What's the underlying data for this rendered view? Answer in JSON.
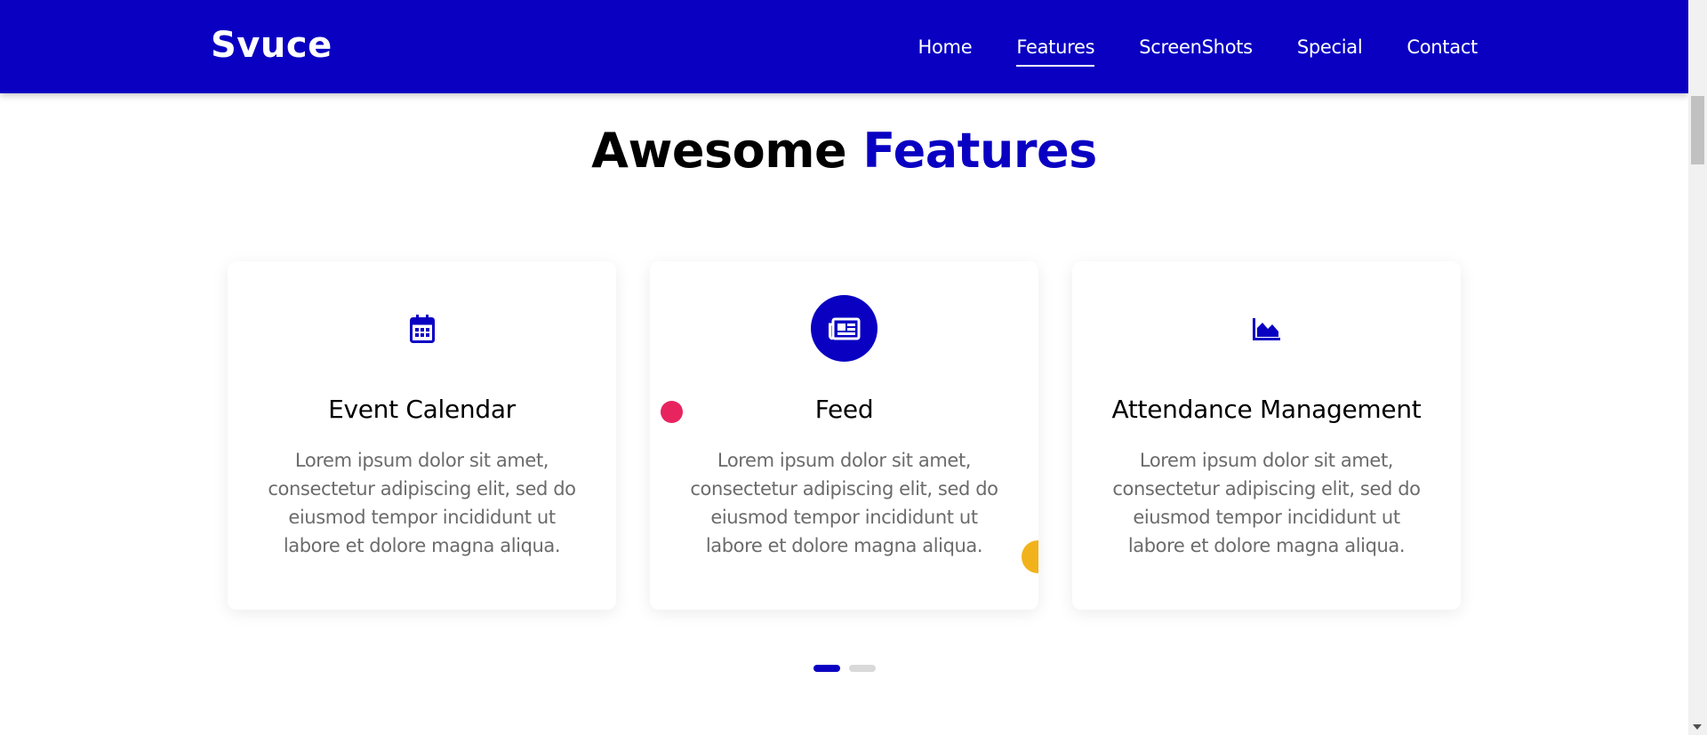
{
  "brand": "Svuce",
  "nav": [
    "Home",
    "Features",
    "ScreenShots",
    "Special",
    "Contact"
  ],
  "nav_active_index": 1,
  "section": {
    "title_prefix": "Awesome",
    "title_accent": "Features"
  },
  "cards": [
    {
      "title": "Event Calendar",
      "icon": "calendar-icon",
      "text": "Lorem ipsum dolor sit amet, consectetur adipiscing elit, sed do eiusmod tempor incididunt ut labore et dolore magna aliqua."
    },
    {
      "title": "Feed",
      "icon": "newspaper-icon",
      "text": "Lorem ipsum dolor sit amet, consectetur adipiscing elit, sed do eiusmod tempor incididunt ut labore et dolore magna aliqua."
    },
    {
      "title": "Attendance Management",
      "icon": "area-chart-icon",
      "text": "Lorem ipsum dolor sit amet, consectetur adipiscing elit, sed do eiusmod tempor incididunt ut labore et dolore magna aliqua."
    }
  ],
  "carousel": {
    "pages": 2,
    "current": 1
  },
  "colors": {
    "primary": "#0a00c2",
    "accent_pink": "#e8245f",
    "accent_yellow": "#f2b21b",
    "body_text": "#6b6b6b"
  }
}
